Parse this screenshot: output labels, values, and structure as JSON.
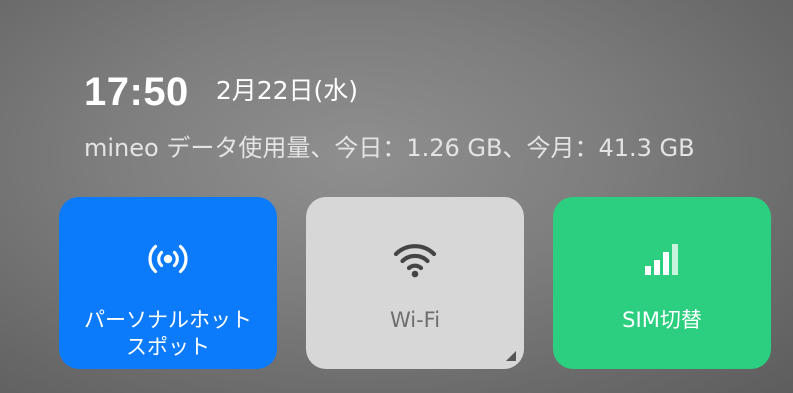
{
  "status": {
    "time": "17:50",
    "date": "2月22日(水)",
    "data_usage": "mineo データ使用量、今日：1.26 GB、今月：41.3 GB"
  },
  "tiles": [
    {
      "label_line1": "パーソナルホット",
      "label_line2": "スポット",
      "icon": "hotspot-icon",
      "color": "#0b7bfb",
      "active": true
    },
    {
      "label": "Wi-Fi",
      "icon": "wifi-icon",
      "color": "#d7d7d7",
      "active": false
    },
    {
      "label": "SIM切替",
      "icon": "signal-bars-icon",
      "color": "#2bcf7f",
      "active": true
    }
  ]
}
